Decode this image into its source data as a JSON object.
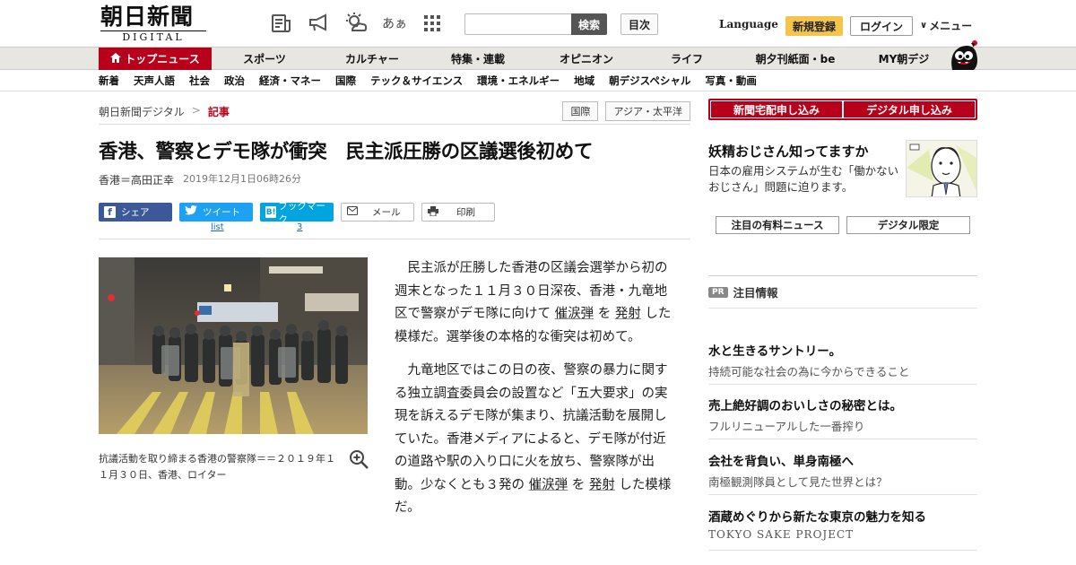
{
  "header": {
    "logo_main": "朝日新聞",
    "logo_sub": "DIGITAL",
    "icons": [
      "newspaper-icon",
      "megaphone-icon",
      "weather-icon",
      "font-size-icon",
      "grid-icon"
    ],
    "font_size_label": "あぁ",
    "search_placeholder": "",
    "search_button": "検索",
    "toc_button": "目次",
    "language": "Language",
    "register": "新規登録",
    "login": "ログイン",
    "menu": "メニュー",
    "menu_chevron": "∨"
  },
  "nav_main": [
    {
      "label": "トップニュース",
      "active": true
    },
    {
      "label": "スポーツ"
    },
    {
      "label": "カルチャー"
    },
    {
      "label": "特集・連載"
    },
    {
      "label": "オピニオン"
    },
    {
      "label": "ライフ"
    },
    {
      "label": "朝夕刊紙面・be"
    },
    {
      "label": "MY朝デジ"
    }
  ],
  "nav_sub": [
    "新着",
    "天声人語",
    "社会",
    "政治",
    "経済・マネー",
    "国際",
    "テック＆サイエンス",
    "環境・エネルギー",
    "地域",
    "朝デジスペシャル",
    "写真・動画"
  ],
  "breadcrumb": {
    "root": "朝日新聞デジタル",
    "sep": ">",
    "current": "記事"
  },
  "tags": [
    "国際",
    "アジア・太平洋"
  ],
  "article": {
    "headline": "香港、警察とデモ隊が衝突　民主派圧勝の区議選後初めて",
    "author": "香港＝高田正幸",
    "date": "2019年12月1日06時26分",
    "caption": "抗議活動を取り締まる香港の警察隊＝＝２０１９年１１月３０日、香港、ロイター",
    "paragraphs": [
      {
        "before": "民主派が圧勝した香港の区議会選挙から初の週末となった１１月３０日深夜、香港・九竜地区で警察がデモ隊に向けて ",
        "link1": "催涙弾",
        "mid": " を ",
        "link2": "発射",
        "after": " した模様だ。選挙後の本格的な衝突は初めて。"
      },
      {
        "before": "九竜地区ではこの日の夜、警察の暴力に関する独立調査委員会の設置など「五大要求」の実現を訴えるデモ隊が集まり、抗議活動を展開していた。香港メディアによると、デモ隊が付近の道路や駅の入り口に火を放ち、警察隊が出動。少なくとも３発の ",
        "link1": "催涙弾",
        "mid": " を ",
        "link2": "発射",
        "after": " した模様だ。"
      }
    ]
  },
  "share": {
    "facebook": "シェア",
    "twitter": "ツイート",
    "twitter_count": "list",
    "hatena": "ブックマーク",
    "hatena_count": "3",
    "mail": "メール",
    "print": "印刷"
  },
  "sidebar": {
    "subscribe_paper": "新聞宅配申し込み",
    "subscribe_digital": "デジタル申し込み",
    "promo_title": "妖精おじさん知ってますか",
    "promo_text": "日本の雇用システムが生む「働かないおじさん」問題に迫ります。",
    "tab_paid": "注目の有料ニュース",
    "tab_digital": "デジタル限定",
    "pr_badge": "PR",
    "pr_label": "注目情報",
    "ads": [
      {
        "title": "水と生きるサントリー。",
        "sub": "持続可能な社会の為に今からできること"
      },
      {
        "title": "売上絶好調のおいしさの秘密とは。",
        "sub": "フルリニューアルした一番搾り"
      },
      {
        "title": "会社を背負い、単身南極へ",
        "sub": "南極観測隊員として見た世界とは？"
      },
      {
        "title": "酒蔵めぐりから新たな東京の魅力を知る",
        "sub": "TOKYO SAKE PROJECT"
      }
    ]
  },
  "colors": {
    "brand_red": "#b8001a",
    "register_yellow": "#f5c44a",
    "facebook": "#3b5998",
    "twitter": "#1da1f2",
    "hatena": "#00a4de"
  }
}
